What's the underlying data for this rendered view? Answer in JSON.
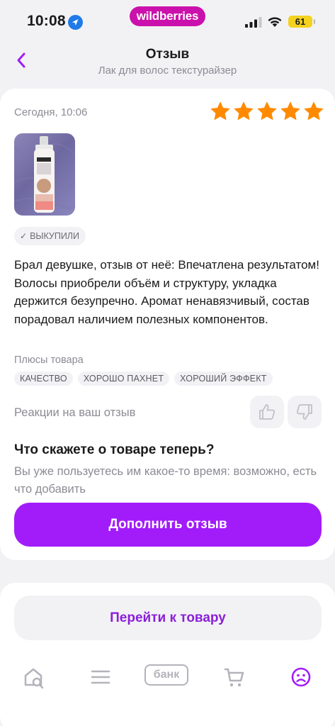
{
  "status_bar": {
    "time": "10:08",
    "battery": "61",
    "brand": "wildberries"
  },
  "header": {
    "title": "Отзыв",
    "subtitle": "Лак для волос текстурайзер",
    "back_icon": "chevron-left-icon"
  },
  "review": {
    "date": "Сегодня, 10:06",
    "rating": 5,
    "rating_max": 5,
    "badge": "ВЫКУПИЛИ",
    "text": "Брал девушке, отзыв от неё: Впечатлена результатом! Волосы приобрели объём и структуру, укладка держится безупречно. Аромат ненавязчивый, состав порадовал наличием полезных компонентов.",
    "pros_label": "Плюсы товара",
    "pros_tags": [
      "КАЧЕСТВО",
      "ХОРОШО ПАХНЕТ",
      "ХОРОШИЙ ЭФФЕКТ"
    ],
    "reactions_label": "Реакции на ваш отзыв",
    "prompt_title": "Что скажете о товаре теперь?",
    "prompt_text": "Вы уже пользуетесь им какое-то время: возможно, есть что добавить",
    "add_button": "Дополнить отзыв"
  },
  "product": {
    "goto_button": "Перейти к товару"
  },
  "bottom_nav": {
    "bank_label": "банк",
    "items": [
      "home-search-icon",
      "catalog-menu-icon",
      "bank-icon",
      "cart-icon",
      "profile-icon"
    ]
  },
  "colors": {
    "accent": "#a21cfa",
    "brand": "#cb11ab",
    "star": "#ff8a00",
    "link": "#8a1fd8"
  }
}
